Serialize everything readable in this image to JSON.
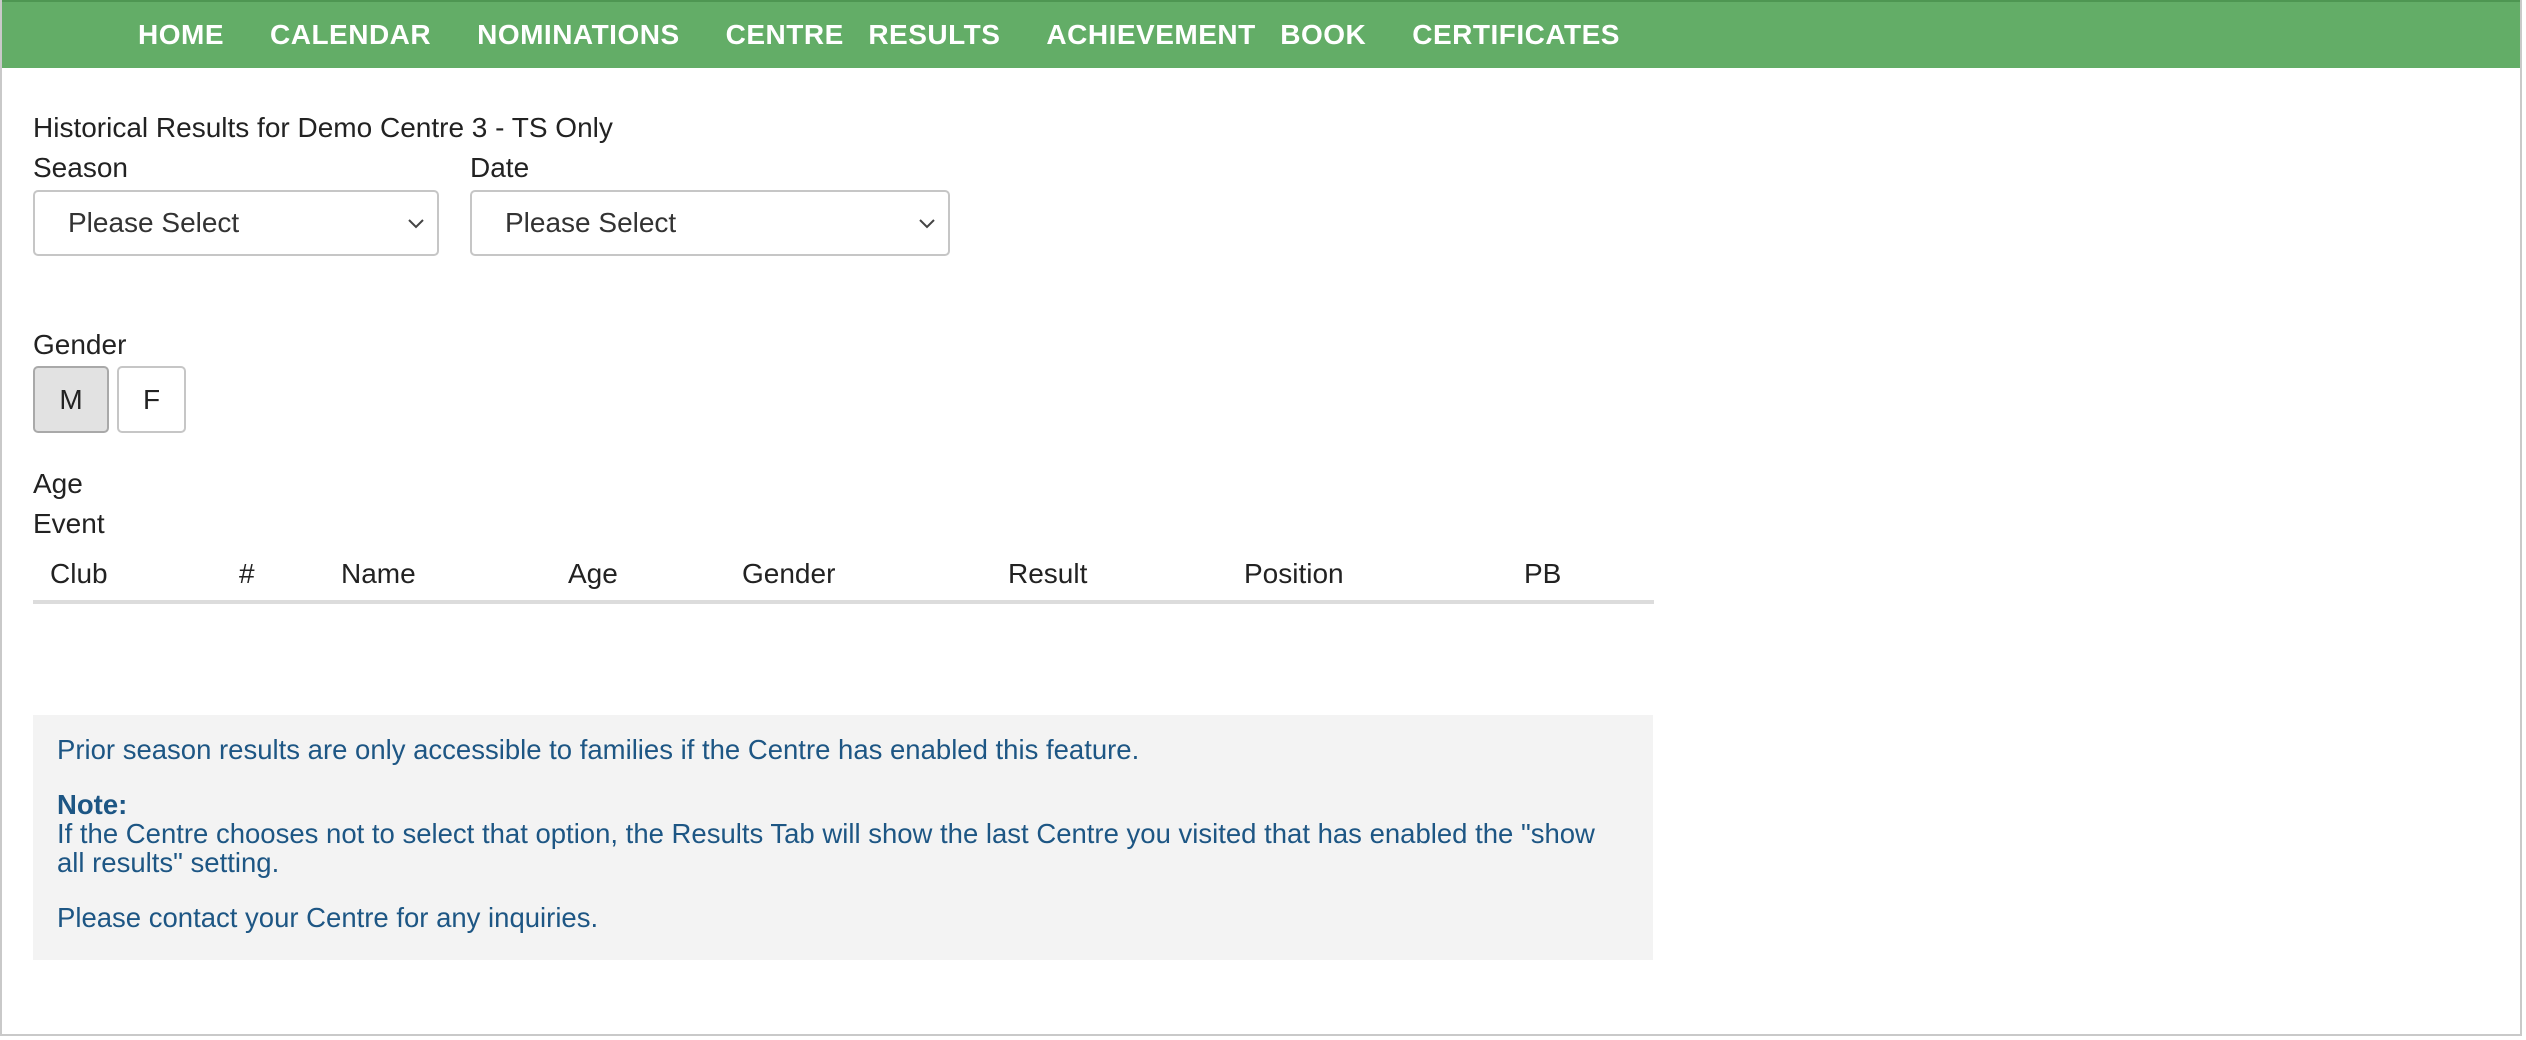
{
  "nav": {
    "items": [
      {
        "label": "HOME"
      },
      {
        "label": "CALENDAR"
      },
      {
        "label": "NOMINATIONS"
      },
      {
        "label": "CENTRE  RESULTS"
      },
      {
        "label": "ACHIEVEMENT  BOOK"
      },
      {
        "label": "CERTIFICATES"
      }
    ]
  },
  "page": {
    "heading": "Historical Results for Demo Centre 3 - TS Only"
  },
  "filters": {
    "season_label": "Season",
    "season_value": "Please Select",
    "date_label": "Date",
    "date_value": "Please Select",
    "gender_label": "Gender",
    "gender_options": [
      {
        "label": "M",
        "selected": true
      },
      {
        "label": "F",
        "selected": false
      }
    ],
    "age_label": "Age",
    "event_label": "Event"
  },
  "table": {
    "columns": [
      "Club",
      "#",
      "Name",
      "Age",
      "Gender",
      "Result",
      "Position",
      "PB"
    ],
    "rows": []
  },
  "notice": {
    "line1": "Prior season results are only accessible to families if the Centre has enabled this feature.",
    "note_title": "Note:",
    "note_body": "If the Centre chooses not to select that option, the Results Tab will show the last Centre you visited that has enabled the \"show all results\" setting.",
    "contact": "Please contact your Centre for any inquiries."
  },
  "colors": {
    "nav_bg": "#63ad67",
    "notice_text": "#1d5684",
    "notice_bg": "#f3f3f3"
  }
}
